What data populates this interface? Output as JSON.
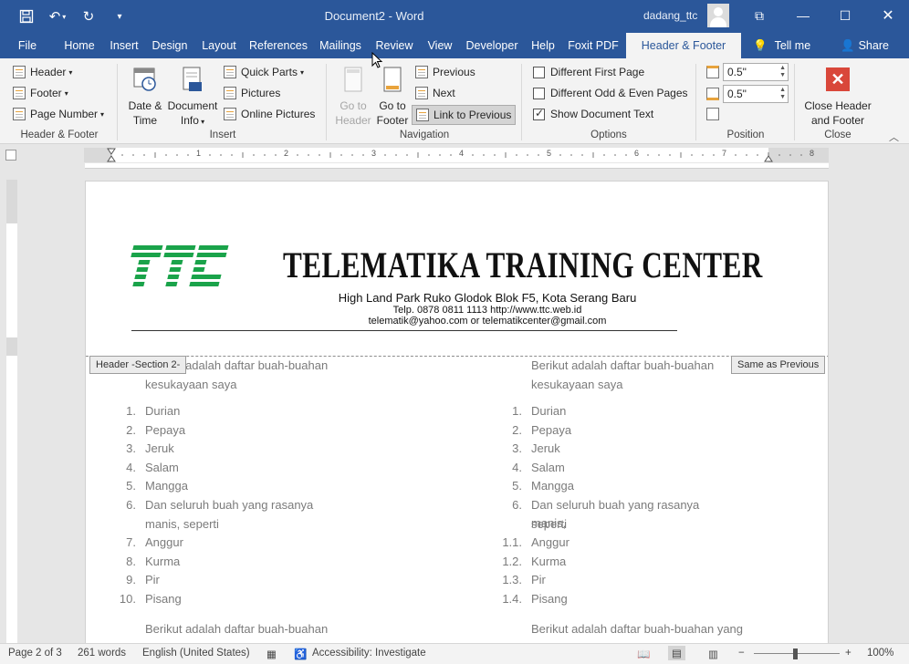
{
  "window": {
    "title": "Document2  -  Word",
    "user": "dadang_ttc"
  },
  "tabs": [
    "File",
    "Home",
    "Insert",
    "Design",
    "Layout",
    "References",
    "Mailings",
    "Review",
    "View",
    "Developer",
    "Help",
    "Foxit PDF",
    "Header & Footer"
  ],
  "tell_me": "Tell me",
  "share": "Share",
  "ribbon": {
    "header_footer": {
      "header": "Header",
      "footer": "Footer",
      "page_number": "Page Number",
      "label": "Header & Footer"
    },
    "insert": {
      "date_time_1": "Date &",
      "date_time_2": "Time",
      "doc_info_1": "Document",
      "doc_info_2": "Info",
      "quick_parts": "Quick Parts",
      "pictures": "Pictures",
      "online_pictures": "Online Pictures",
      "label": "Insert"
    },
    "navigation": {
      "goto_header_1": "Go to",
      "goto_header_2": "Header",
      "goto_footer_1": "Go to",
      "goto_footer_2": "Footer",
      "previous": "Previous",
      "next": "Next",
      "link_previous": "Link to Previous",
      "label": "Navigation"
    },
    "options": {
      "diff_first": "Different First Page",
      "diff_odd_even": "Different Odd & Even Pages",
      "show_doc_text": "Show Document Text",
      "label": "Options",
      "diff_first_checked": false,
      "diff_odd_even_checked": false,
      "show_doc_text_checked": true
    },
    "position": {
      "header_pos": "0.5\"",
      "footer_pos": "0.5\"",
      "label": "Position"
    },
    "close": {
      "line1": "Close Header",
      "line2": "and Footer",
      "label": "Close"
    }
  },
  "document": {
    "header": {
      "title": "TELEMATIKA TRAINING CENTER",
      "address": "High Land Park Ruko Glodok Blok F5, Kota Serang Baru",
      "contact1": "Telp. 0878 0811 1113  http://www.ttc.web.id",
      "contact2": "telematik@yahoo.com or telematikcenter@gmail.com",
      "section_tag": "Header -Section 2-",
      "same_as_prev": "Same as Previous"
    },
    "left_column": {
      "intro_1": "Berikut adalah daftar buah-buahan",
      "intro_2": "kesukayaan saya",
      "items": [
        {
          "n": "1.",
          "t": "Durian"
        },
        {
          "n": "2.",
          "t": "Pepaya"
        },
        {
          "n": "3.",
          "t": "Jeruk"
        },
        {
          "n": "4.",
          "t": "Salam"
        },
        {
          "n": "5.",
          "t": "Mangga"
        },
        {
          "n": "6.",
          "t": "Dan seluruh buah yang rasanya"
        },
        {
          "n": "",
          "t": "manis, seperti"
        },
        {
          "n": "7.",
          "t": "Anggur"
        },
        {
          "n": "8.",
          "t": "Kurma"
        },
        {
          "n": "9.",
          "t": "Pir"
        },
        {
          "n": "10.",
          "t": "Pisang"
        }
      ],
      "outro": "Berikut adalah daftar buah-buahan"
    },
    "right_column": {
      "intro_1": "Berikut adalah daftar buah-buahan",
      "intro_2": "kesukayaan saya",
      "items": [
        {
          "n": "1.",
          "t": "Durian"
        },
        {
          "n": "2.",
          "t": "Pepaya"
        },
        {
          "n": "3.",
          "t": "Jeruk"
        },
        {
          "n": "4.",
          "t": "Salam"
        },
        {
          "n": "5.",
          "t": "Mangga"
        },
        {
          "n": "6.",
          "t": "Dan seluruh buah yang rasanya manis,"
        },
        {
          "n": "",
          "t": "seperti"
        },
        {
          "n": "1.1.",
          "t": "Anggur"
        },
        {
          "n": "1.2.",
          "t": "Kurma"
        },
        {
          "n": "1.3.",
          "t": "Pir"
        },
        {
          "n": "1.4.",
          "t": "Pisang"
        }
      ],
      "outro": "Berikut adalah daftar buah-buahan yang"
    }
  },
  "status": {
    "page": "Page 2 of 3",
    "words": "261 words",
    "language": "English (United States)",
    "accessibility": "Accessibility: Investigate",
    "zoom": "100%"
  },
  "ruler_numbers": [
    "1",
    "2",
    "3",
    "4",
    "5",
    "6",
    "7",
    "8"
  ],
  "colors": {
    "brand": "#2b579a",
    "logo_green": "#1aa34a"
  }
}
